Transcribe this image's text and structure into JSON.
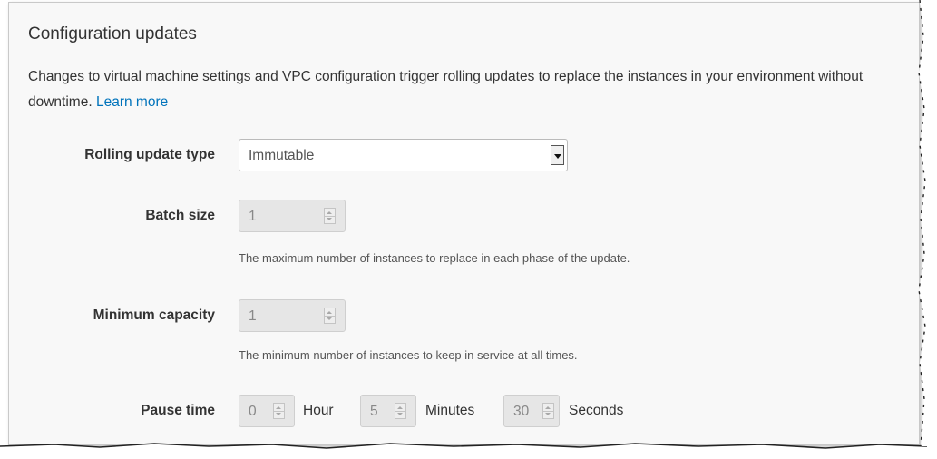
{
  "section": {
    "title": "Configuration updates",
    "description": "Changes to virtual machine settings and VPC configuration trigger rolling updates to replace the instances in your environment without downtime.",
    "learn_more": "Learn more"
  },
  "rolling_update_type": {
    "label": "Rolling update type",
    "value": "Immutable"
  },
  "batch_size": {
    "label": "Batch size",
    "value": "1",
    "help": "The maximum number of instances to replace in each phase of the update."
  },
  "minimum_capacity": {
    "label": "Minimum capacity",
    "value": "1",
    "help": "The minimum number of instances to keep in service at all times."
  },
  "pause_time": {
    "label": "Pause time",
    "hour_value": "0",
    "hour_label": "Hour",
    "minutes_value": "5",
    "minutes_label": "Minutes",
    "seconds_value": "30",
    "seconds_label": "Seconds"
  },
  "colors": {
    "link": "#0073bb",
    "text": "#333333",
    "panel_bg": "#f8f8f8",
    "disabled_input_bg": "#e6e6e6"
  },
  "icons": [
    "chevron-down-icon",
    "spinner-arrows-icon"
  ]
}
